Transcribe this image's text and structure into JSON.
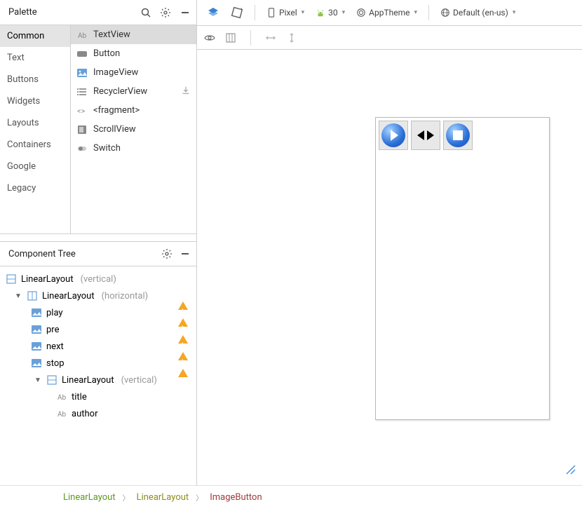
{
  "palette": {
    "title": "Palette",
    "categories": [
      "Common",
      "Text",
      "Buttons",
      "Widgets",
      "Layouts",
      "Containers",
      "Google",
      "Legacy"
    ],
    "selected_category": "Common",
    "items": [
      {
        "label": "TextView",
        "icon": "textview"
      },
      {
        "label": "Button",
        "icon": "button"
      },
      {
        "label": "ImageView",
        "icon": "image"
      },
      {
        "label": "RecyclerView",
        "icon": "list",
        "downloadable": true
      },
      {
        "label": "<fragment>",
        "icon": "fragment"
      },
      {
        "label": "ScrollView",
        "icon": "scroll"
      },
      {
        "label": "Switch",
        "icon": "switch"
      }
    ],
    "selected_item": "TextView"
  },
  "component_tree": {
    "title": "Component Tree",
    "nodes": [
      {
        "indent": 0,
        "icon": "layout-v",
        "label": "LinearLayout",
        "suffix": "(vertical)"
      },
      {
        "indent": 1,
        "twisty": "▼",
        "icon": "layout-h",
        "label": "LinearLayout",
        "suffix": "(horizontal)",
        "warn": true
      },
      {
        "indent": 2,
        "icon": "image",
        "label": "play",
        "warn": true
      },
      {
        "indent": 2,
        "icon": "image",
        "label": "pre",
        "warn": true
      },
      {
        "indent": 2,
        "icon": "image",
        "label": "next",
        "warn": true
      },
      {
        "indent": 2,
        "icon": "image",
        "label": "stop",
        "warn": true
      },
      {
        "indent": 3,
        "twisty": "▼",
        "icon": "layout-v",
        "label": "LinearLayout",
        "suffix": "(vertical)"
      },
      {
        "indent": 4,
        "icon": "text",
        "label": "title"
      },
      {
        "indent": 4,
        "icon": "text",
        "label": "author"
      }
    ]
  },
  "toolbar": {
    "device": "Pixel",
    "api": "30",
    "theme": "AppTheme",
    "locale": "Default (en-us)"
  },
  "breadcrumb": {
    "items": [
      "LinearLayout",
      "LinearLayout",
      "ImageButton"
    ]
  }
}
